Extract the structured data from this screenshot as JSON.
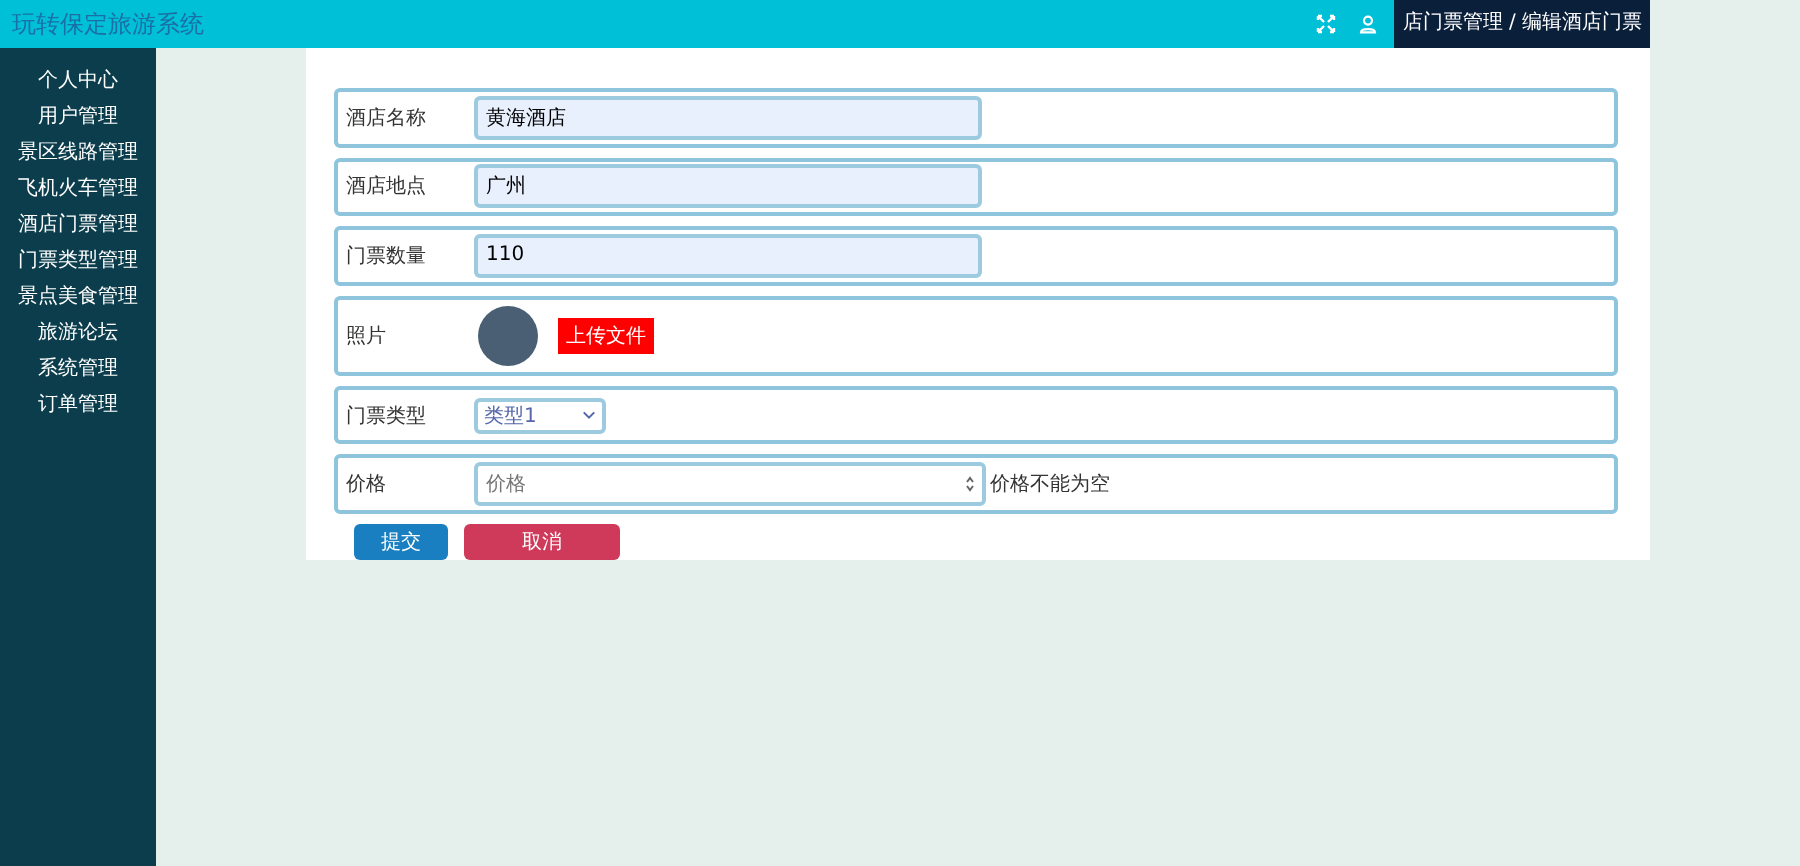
{
  "header": {
    "title": "玩转保定旅游系统",
    "breadcrumb": "店门票管理 / 编辑酒店门票"
  },
  "sidebar": {
    "items": [
      {
        "label": "个人中心"
      },
      {
        "label": "用户管理"
      },
      {
        "label": "景区线路管理"
      },
      {
        "label": "飞机火车管理"
      },
      {
        "label": "酒店门票管理"
      },
      {
        "label": "门票类型管理"
      },
      {
        "label": "景点美食管理"
      },
      {
        "label": "旅游论坛"
      },
      {
        "label": "系统管理"
      },
      {
        "label": "订单管理"
      }
    ]
  },
  "form": {
    "fields": [
      {
        "kind": "text",
        "label": "酒店名称",
        "value": "黄海酒店"
      },
      {
        "kind": "text",
        "label": "酒店地点",
        "value": "广州"
      },
      {
        "kind": "text",
        "label": "门票数量",
        "value": "110"
      },
      {
        "kind": "image",
        "label": "照片",
        "button": "上传文件"
      },
      {
        "kind": "select",
        "label": "门票类型",
        "value": "类型1"
      },
      {
        "kind": "number",
        "label": "价格",
        "placeholder": "价格",
        "error": "价格不能为空"
      }
    ],
    "buttons": [
      {
        "kind": "submit",
        "label": "提交"
      },
      {
        "kind": "cancel",
        "label": "取消"
      }
    ]
  }
}
